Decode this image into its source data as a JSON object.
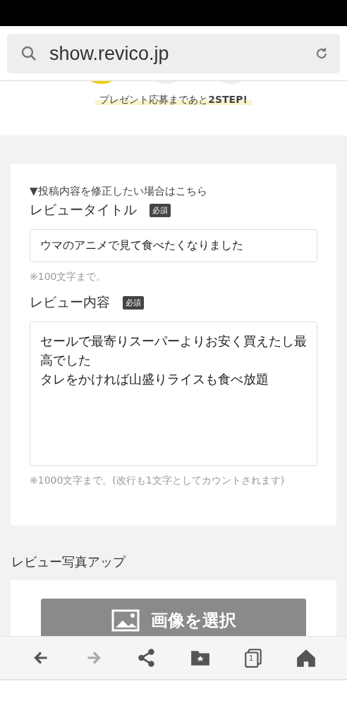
{
  "address_bar": {
    "url": "show.revico.jp"
  },
  "steps": [
    {
      "selected": true
    },
    {
      "selected": false
    },
    {
      "selected": false
    }
  ],
  "step_message": "プレゼント応募まであと**2STEP!**",
  "edit_toggle": {
    "label": "▼投稿内容を修正したい場合はこちら"
  },
  "fields": [
    {
      "kind": "input",
      "label": "レビュータイトル",
      "badge": "必須",
      "value": "ウマのアニメで見て食べたくなりました",
      "hint": "※100文字まで。"
    },
    {
      "kind": "textarea",
      "label": "レビュー内容",
      "badge": "必須",
      "lines": [
        "セールで最寄りスーパーよりお安く買えたし最高でした",
        "タレをかければ山盛りライスも食べ放題"
      ],
      "hint": "※1000文字まで。(改行も1文字としてカウントされます)"
    }
  ],
  "photo_section": {
    "title": "レビュー写真アップ",
    "button": "画像を選択"
  },
  "bottom_nav": [
    {
      "kind": "back",
      "disabled": false
    },
    {
      "kind": "forward",
      "disabled": true
    },
    {
      "kind": "share",
      "disabled": false
    },
    {
      "kind": "bookmarks",
      "disabled": false
    },
    {
      "kind": "tabs",
      "disabled": false,
      "count": "1"
    },
    {
      "kind": "home",
      "disabled": false
    }
  ]
}
